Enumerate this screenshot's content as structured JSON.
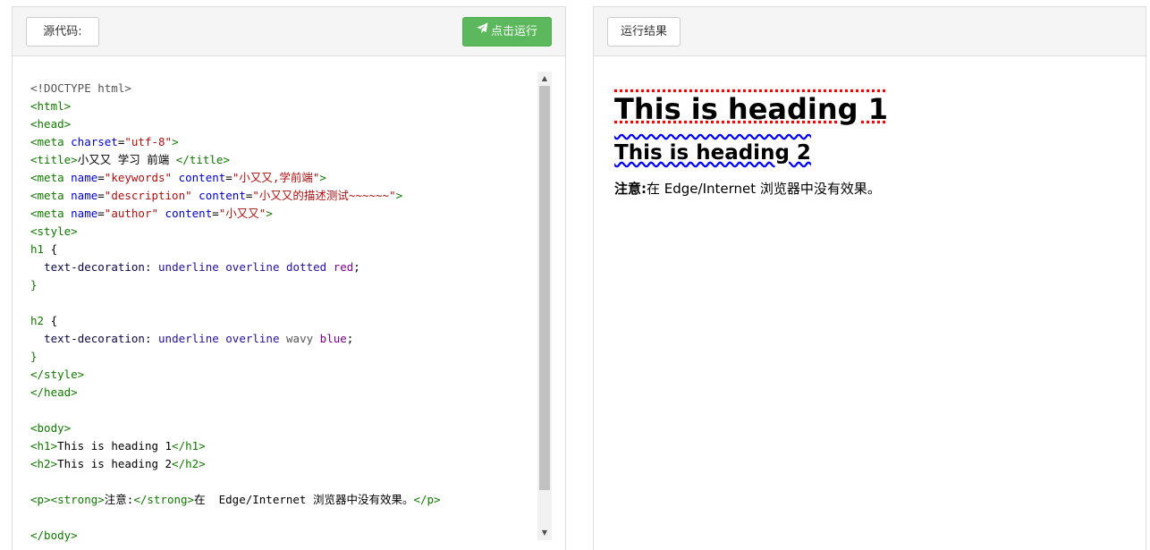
{
  "left_panel": {
    "source_label": "源代码:",
    "run_label": "点击运行",
    "code_lines": [
      [
        {
          "t": "<!DOCTYPE html>",
          "c": "doc"
        }
      ],
      [
        {
          "t": "<html>",
          "c": "tag"
        }
      ],
      [
        {
          "t": "<head>",
          "c": "tag"
        }
      ],
      [
        {
          "t": "<meta ",
          "c": "tag"
        },
        {
          "t": "charset",
          "c": "attr"
        },
        {
          "t": "=",
          "c": "text"
        },
        {
          "t": "\"utf-8\"",
          "c": "str"
        },
        {
          "t": ">",
          "c": "tag"
        }
      ],
      [
        {
          "t": "<title>",
          "c": "tag"
        },
        {
          "t": "小又又 学习 前端 ",
          "c": "text"
        },
        {
          "t": "</title>",
          "c": "tag"
        }
      ],
      [
        {
          "t": "<meta ",
          "c": "tag"
        },
        {
          "t": "name",
          "c": "attr"
        },
        {
          "t": "=",
          "c": "text"
        },
        {
          "t": "\"keywords\"",
          "c": "str"
        },
        {
          "t": " ",
          "c": "text"
        },
        {
          "t": "content",
          "c": "attr"
        },
        {
          "t": "=",
          "c": "text"
        },
        {
          "t": "\"小又又,学前端\"",
          "c": "str"
        },
        {
          "t": ">",
          "c": "tag"
        }
      ],
      [
        {
          "t": "<meta ",
          "c": "tag"
        },
        {
          "t": "name",
          "c": "attr"
        },
        {
          "t": "=",
          "c": "text"
        },
        {
          "t": "\"description\"",
          "c": "str"
        },
        {
          "t": " ",
          "c": "text"
        },
        {
          "t": "content",
          "c": "attr"
        },
        {
          "t": "=",
          "c": "text"
        },
        {
          "t": "\"小又又的描述测试~~~~~~\"",
          "c": "str"
        },
        {
          "t": ">",
          "c": "tag"
        }
      ],
      [
        {
          "t": "<meta ",
          "c": "tag"
        },
        {
          "t": "name",
          "c": "attr"
        },
        {
          "t": "=",
          "c": "text"
        },
        {
          "t": "\"author\"",
          "c": "str"
        },
        {
          "t": " ",
          "c": "text"
        },
        {
          "t": "content",
          "c": "attr"
        },
        {
          "t": "=",
          "c": "text"
        },
        {
          "t": "\"小又又\"",
          "c": "str"
        },
        {
          "t": ">",
          "c": "tag"
        }
      ],
      [
        {
          "t": "<style>",
          "c": "tag"
        }
      ],
      [
        {
          "t": "h1",
          "c": "tag"
        },
        {
          "t": " {",
          "c": "text"
        }
      ],
      [
        {
          "t": "  ",
          "c": "text"
        },
        {
          "t": "text-decoration",
          "c": "prop"
        },
        {
          "t": ": ",
          "c": "text"
        },
        {
          "t": "underline",
          "c": "kw"
        },
        {
          "t": " ",
          "c": "text"
        },
        {
          "t": "overline",
          "c": "kw"
        },
        {
          "t": " ",
          "c": "text"
        },
        {
          "t": "dotted",
          "c": "kw"
        },
        {
          "t": " ",
          "c": "text"
        },
        {
          "t": "red",
          "c": "val"
        },
        {
          "t": ";",
          "c": "text"
        }
      ],
      [
        {
          "t": "}",
          "c": "tag"
        }
      ],
      [],
      [
        {
          "t": "h2",
          "c": "tag"
        },
        {
          "t": " {",
          "c": "text"
        }
      ],
      [
        {
          "t": "  ",
          "c": "text"
        },
        {
          "t": "text-decoration",
          "c": "prop"
        },
        {
          "t": ": ",
          "c": "text"
        },
        {
          "t": "underline",
          "c": "kw"
        },
        {
          "t": " ",
          "c": "text"
        },
        {
          "t": "overline",
          "c": "kw"
        },
        {
          "t": " ",
          "c": "text"
        },
        {
          "t": "wavy",
          "c": "doc"
        },
        {
          "t": " ",
          "c": "text"
        },
        {
          "t": "blue",
          "c": "val"
        },
        {
          "t": ";",
          "c": "text"
        }
      ],
      [
        {
          "t": "}",
          "c": "tag"
        }
      ],
      [
        {
          "t": "</style>",
          "c": "tag"
        }
      ],
      [
        {
          "t": "</head>",
          "c": "tag"
        }
      ],
      [],
      [
        {
          "t": "<body>",
          "c": "tag"
        }
      ],
      [
        {
          "t": "<h1>",
          "c": "tag"
        },
        {
          "t": "This is heading 1",
          "c": "text"
        },
        {
          "t": "</h1>",
          "c": "tag"
        }
      ],
      [
        {
          "t": "<h2>",
          "c": "tag"
        },
        {
          "t": "This is heading 2",
          "c": "text"
        },
        {
          "t": "</h2>",
          "c": "tag"
        }
      ],
      [],
      [
        {
          "t": "<p><strong>",
          "c": "tag"
        },
        {
          "t": "注意:",
          "c": "text"
        },
        {
          "t": "</strong>",
          "c": "tag"
        },
        {
          "t": "在  Edge/Internet 浏览器中没有效果。",
          "c": "text"
        },
        {
          "t": "</p>",
          "c": "tag"
        }
      ],
      [],
      [
        {
          "t": "</body>",
          "c": "tag"
        }
      ]
    ]
  },
  "right_panel": {
    "result_label": "运行结果",
    "h1": "This is heading 1",
    "h2": "This is heading 2",
    "note_strong": "注意:",
    "note_text": "在 Edge/Internet 浏览器中没有效果。"
  },
  "colors": {
    "run_button": "#5cb85c",
    "h1_decoration": "red",
    "h2_decoration": "blue"
  },
  "icons": {
    "run_icon": "paper-plane-icon",
    "scroll_up": "triangle-up-icon",
    "scroll_down": "triangle-down-icon"
  }
}
